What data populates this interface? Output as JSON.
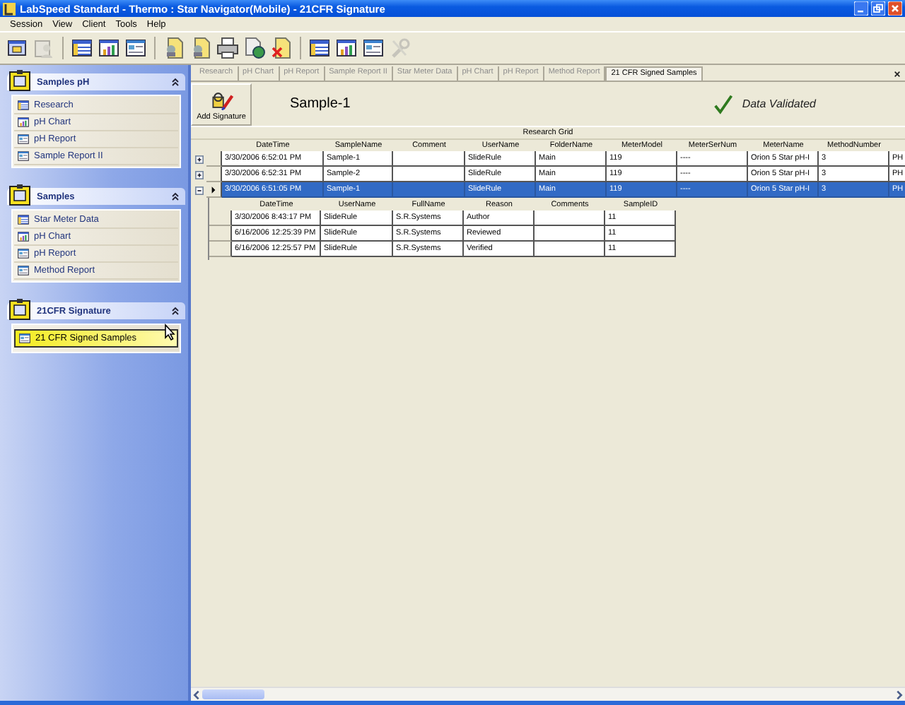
{
  "window": {
    "title": "LabSpeed Standard - Thermo : Star Navigator(Mobile) - 21CFR Signature"
  },
  "menu": [
    "Session",
    "View",
    "Client",
    "Tools",
    "Help"
  ],
  "toolbar_groups": [
    {
      "buttons": [
        {
          "kind": "window",
          "disabled": false
        },
        {
          "kind": "user",
          "disabled": true
        }
      ]
    },
    {
      "buttons": [
        {
          "kind": "grid",
          "disabled": false
        },
        {
          "kind": "chart",
          "disabled": false
        },
        {
          "kind": "form",
          "disabled": false
        }
      ]
    },
    {
      "buttons": [
        {
          "kind": "doc-user",
          "disabled": false
        },
        {
          "kind": "doc-user",
          "disabled": false
        },
        {
          "kind": "printer",
          "disabled": false
        },
        {
          "kind": "doc-globe",
          "disabled": false
        },
        {
          "kind": "doc-delete",
          "disabled": false
        }
      ]
    },
    {
      "buttons": [
        {
          "kind": "grid",
          "disabled": false
        },
        {
          "kind": "chart",
          "disabled": false
        },
        {
          "kind": "form",
          "disabled": false
        },
        {
          "kind": "tools",
          "disabled": true
        }
      ]
    }
  ],
  "sidebar": {
    "groups": [
      {
        "title": "Samples pH",
        "expanded": true,
        "items": [
          {
            "label": "Research",
            "kind": "grid",
            "selected": false
          },
          {
            "label": "pH Chart",
            "kind": "chart",
            "selected": false
          },
          {
            "label": "pH Report",
            "kind": "form",
            "selected": false
          },
          {
            "label": "Sample Report II",
            "kind": "form",
            "selected": false
          }
        ]
      },
      {
        "title": "Samples",
        "expanded": true,
        "items": [
          {
            "label": "Star Meter Data",
            "kind": "grid",
            "selected": false
          },
          {
            "label": "pH Chart",
            "kind": "chart",
            "selected": false
          },
          {
            "label": "pH Report",
            "kind": "form",
            "selected": false
          },
          {
            "label": "Method Report",
            "kind": "form",
            "selected": false
          }
        ]
      },
      {
        "title": "21CFR Signature",
        "expanded": true,
        "items": [
          {
            "label": "21 CFR Signed Samples",
            "kind": "form",
            "selected": true
          }
        ]
      }
    ]
  },
  "tabs": [
    {
      "label": "Research",
      "selected": false
    },
    {
      "label": "pH Chart",
      "selected": false
    },
    {
      "label": "pH Report",
      "selected": false
    },
    {
      "label": "Sample Report II",
      "selected": false
    },
    {
      "label": "Star Meter Data",
      "selected": false
    },
    {
      "label": "pH Chart",
      "selected": false
    },
    {
      "label": "pH Report",
      "selected": false
    },
    {
      "label": "Method Report",
      "selected": false
    },
    {
      "label": "21 CFR Signed Samples",
      "selected": true
    }
  ],
  "header": {
    "button": "Add Signature",
    "sample": "Sample-1",
    "status": "Data Validated",
    "validated": true
  },
  "grid": {
    "title": "Research Grid",
    "columns": [
      "DateTime",
      "SampleName",
      "Comment",
      "UserName",
      "FolderName",
      "MeterModel",
      "MeterSerNum",
      "MeterName",
      "MethodNumber"
    ],
    "rows": [
      {
        "cells": [
          "3/30/2006 6:52:01 PM",
          "Sample-1",
          null,
          "SlideRule",
          "Main",
          "119",
          "----",
          "Orion 5 Star pH-I",
          "3",
          "PH"
        ],
        "expanded": false,
        "selected": false
      },
      {
        "cells": [
          "3/30/2006 6:52:31 PM",
          "Sample-2",
          null,
          "SlideRule",
          "Main",
          "119",
          "----",
          "Orion 5 Star pH-I",
          "3",
          "PH"
        ],
        "expanded": false,
        "selected": false
      },
      {
        "cells": [
          "3/30/2006 6:51:05 PM",
          "Sample-1",
          null,
          "SlideRule",
          "Main",
          "119",
          "----",
          "Orion 5 Star pH-I",
          "3",
          "PH"
        ],
        "expanded": true,
        "selected": true,
        "signatures": {
          "columns": [
            "DateTime",
            "UserName",
            "FullName",
            "Reason",
            "Comments",
            "SampleID"
          ],
          "rows": [
            [
              "3/30/2006 8:43:17 PM",
              "SlideRule",
              "S.R.Systems",
              "Author",
              null,
              "11"
            ],
            [
              "6/16/2006 12:25:39 PM",
              "SlideRule",
              "S.R.Systems",
              "Reviewed",
              null,
              "11"
            ],
            [
              "6/16/2006 12:25:57 PM",
              "SlideRule",
              "S.R.Systems",
              "Verified",
              null,
              "11"
            ]
          ]
        }
      }
    ]
  }
}
